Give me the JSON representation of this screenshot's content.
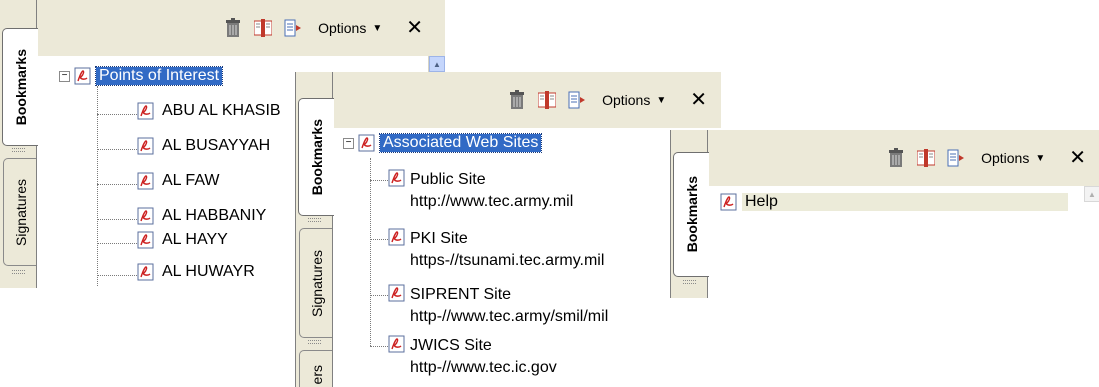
{
  "panel1": {
    "tabs": [
      "Bookmarks",
      "Signatures"
    ],
    "toolbar": {
      "options_label": "Options",
      "close_label": "✕"
    },
    "root": "Points of Interest",
    "children": [
      "ABU AL KHASIB",
      "AL BUSAYYAH",
      "AL FAW",
      "AL HABBANIY",
      "AL HAYY",
      "AL HUWAYR"
    ]
  },
  "panel2": {
    "tabs": [
      "Bookmarks",
      "Signatures",
      "ers"
    ],
    "toolbar": {
      "options_label": "Options",
      "close_label": "✕"
    },
    "root": "Associated Web Sites",
    "children": [
      {
        "title": "Public Site",
        "url": "http://www.tec.army.mil"
      },
      {
        "title": "PKI Site",
        "url": "https-//tsunami.tec.army.mil"
      },
      {
        "title": "SIPRENT Site",
        "url": "http-//www.tec.army/smil/mil"
      },
      {
        "title": "JWICS Site",
        "url": "http-//www.tec.ic.gov"
      }
    ]
  },
  "panel3": {
    "tabs": [
      "Bookmarks"
    ],
    "toolbar": {
      "options_label": "Options",
      "close_label": "✕"
    },
    "item": "Help"
  },
  "icons": [
    "trash-icon",
    "bookmark-expand-icon",
    "bookmark-goto-icon",
    "pdf-bookmark-icon",
    "expander-minus-icon"
  ],
  "colors": {
    "chrome": "#ece9d8",
    "selection": "#316ac5",
    "hover": "#ecebd9"
  }
}
